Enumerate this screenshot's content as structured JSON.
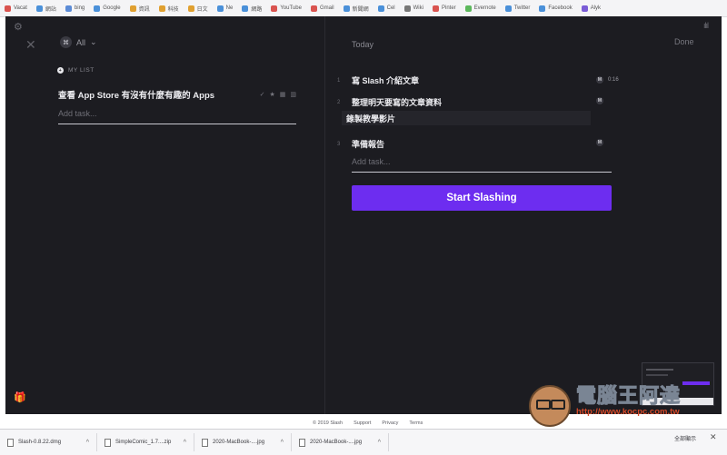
{
  "browser": {
    "bookmarks": [
      {
        "label": "Vacat",
        "color": "#d9534f"
      },
      {
        "label": "網站",
        "color": "#4a90d9"
      },
      {
        "label": "bing",
        "color": "#5b8bd6"
      },
      {
        "label": "Google",
        "color": "#4a90d9"
      },
      {
        "label": "資訊",
        "color": "#e0a030"
      },
      {
        "label": "科技",
        "color": "#e0a030"
      },
      {
        "label": "日文",
        "color": "#e0a030"
      },
      {
        "label": "Ne",
        "color": "#4a90d9"
      },
      {
        "label": "網路",
        "color": "#4a90d9"
      },
      {
        "label": "YouTube",
        "color": "#d9534f"
      },
      {
        "label": "Gmail",
        "color": "#d9534f"
      },
      {
        "label": "新聞網",
        "color": "#4a90d9"
      },
      {
        "label": "Cel",
        "color": "#4a90d9"
      },
      {
        "label": "Wiki",
        "color": "#777777"
      },
      {
        "label": "Pinter",
        "color": "#d9534f"
      },
      {
        "label": "Evernote",
        "color": "#5cb85c"
      },
      {
        "label": "Twitter",
        "color": "#4a90d9"
      },
      {
        "label": "Facebook",
        "color": "#4a90d9"
      },
      {
        "label": "Alyk",
        "color": "#7a5cd6"
      }
    ]
  },
  "app": {
    "filter_label": "All",
    "list_title": "MY LIST",
    "left_task": "查看 App Store 有沒有什麼有趣的 Apps",
    "add_task_placeholder": "Add task...",
    "today_label": "Today",
    "done_label": "Done",
    "today_tasks": [
      {
        "num": "1",
        "text": "寫 Slash 介紹文章",
        "badge": "M",
        "time": "0:16"
      },
      {
        "num": "2",
        "text": "整理明天要寫的文章資料",
        "badge": "M",
        "time": ""
      },
      {
        "num": "3",
        "text": "準備報告",
        "badge": "M",
        "time": ""
      }
    ],
    "editing_task": "錄製教學影片",
    "start_button": "Start Slashing",
    "footer": [
      "© 2019 Slash",
      "Support",
      "Privacy",
      "Terms"
    ],
    "accent_color": "#6d2df0"
  },
  "watermark": {
    "brand": "電腦王阿達",
    "url": "http://www.kocpc.com.tw"
  },
  "downloads": {
    "items": [
      "Slash-0.8.22.dmg",
      "SimpleComic_1.7....zip",
      "2020-MacBook-....jpg",
      "2020-MacBook-....jpg"
    ],
    "show_all": "全部顯示"
  }
}
